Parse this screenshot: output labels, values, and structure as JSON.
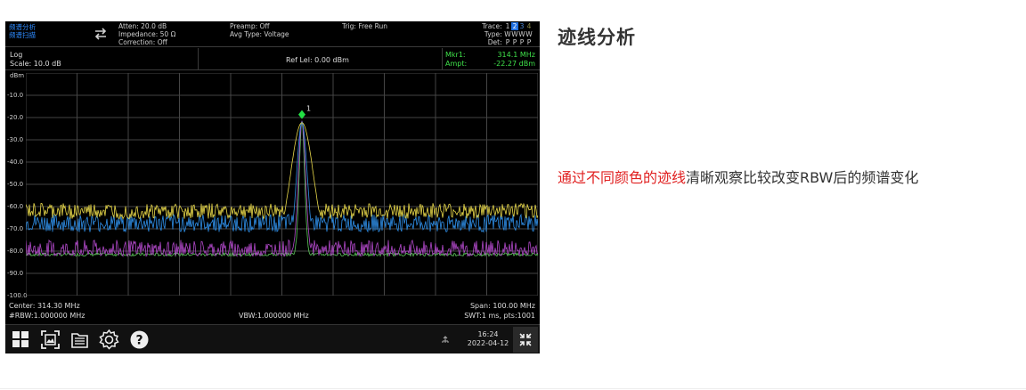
{
  "header": {
    "mode_line1": "频谱分析",
    "mode_line2": "频谱扫描",
    "atten": "Atten: 20.0 dB",
    "impedance": "Impedance: 50 Ω",
    "correction": "Correction: Off",
    "preamp": "Preamp: Off",
    "avg_type": "Avg Type: Voltage",
    "trig": "Trig: Free Run",
    "trace_row": {
      "label": "Trace:",
      "items": [
        "1",
        "2",
        "3",
        "4"
      ]
    },
    "type_row": {
      "label": "Type:",
      "items": [
        "W",
        "W",
        "W",
        "W"
      ]
    },
    "det_row": {
      "label": "Det:",
      "items": [
        "P",
        "P",
        "P",
        "P"
      ]
    }
  },
  "info": {
    "log": "Log",
    "scale": "Scale: 10.0 dB",
    "ref_level": "Ref Lel: 0.00 dBm",
    "marker_label": "Mkr1:",
    "marker_freq": "314.1 MHz",
    "ampt_label": "Ampt:",
    "ampt_value": "-22.27 dBm"
  },
  "plot": {
    "y_unit": "dBm",
    "y_labels": [
      "-10.0",
      "-20.0",
      "-30.0",
      "-40.0",
      "-50.0",
      "-60.0",
      "-70.0",
      "-80.0",
      "-90.0",
      "-100.0"
    ],
    "marker_number": "1",
    "trace_colors": {
      "trace1": "#e8d84a",
      "trace2": "#2f8fe8",
      "trace3": "#b048c8",
      "trace4": "#5cc85a"
    },
    "marker_color": "#22e044"
  },
  "footer": {
    "center": "Center: 314.30 MHz",
    "rbw": "#RBW:1.000000 MHz",
    "vbw": "VBW:1.000000 MHz",
    "span": "Span: 100.00 MHz",
    "swt": "SWT:1 ms, pts:1001"
  },
  "taskbar": {
    "icons": [
      "grid-icon",
      "screenshot-icon",
      "file-icon",
      "settings-icon",
      "help-icon"
    ],
    "time": "16:24",
    "date": "2022-04-12"
  },
  "article": {
    "heading": "迹线分析",
    "highlight": "通过不同颜色的迹线",
    "rest": "清晰观察比较改变RBW后的频谱变化"
  }
}
